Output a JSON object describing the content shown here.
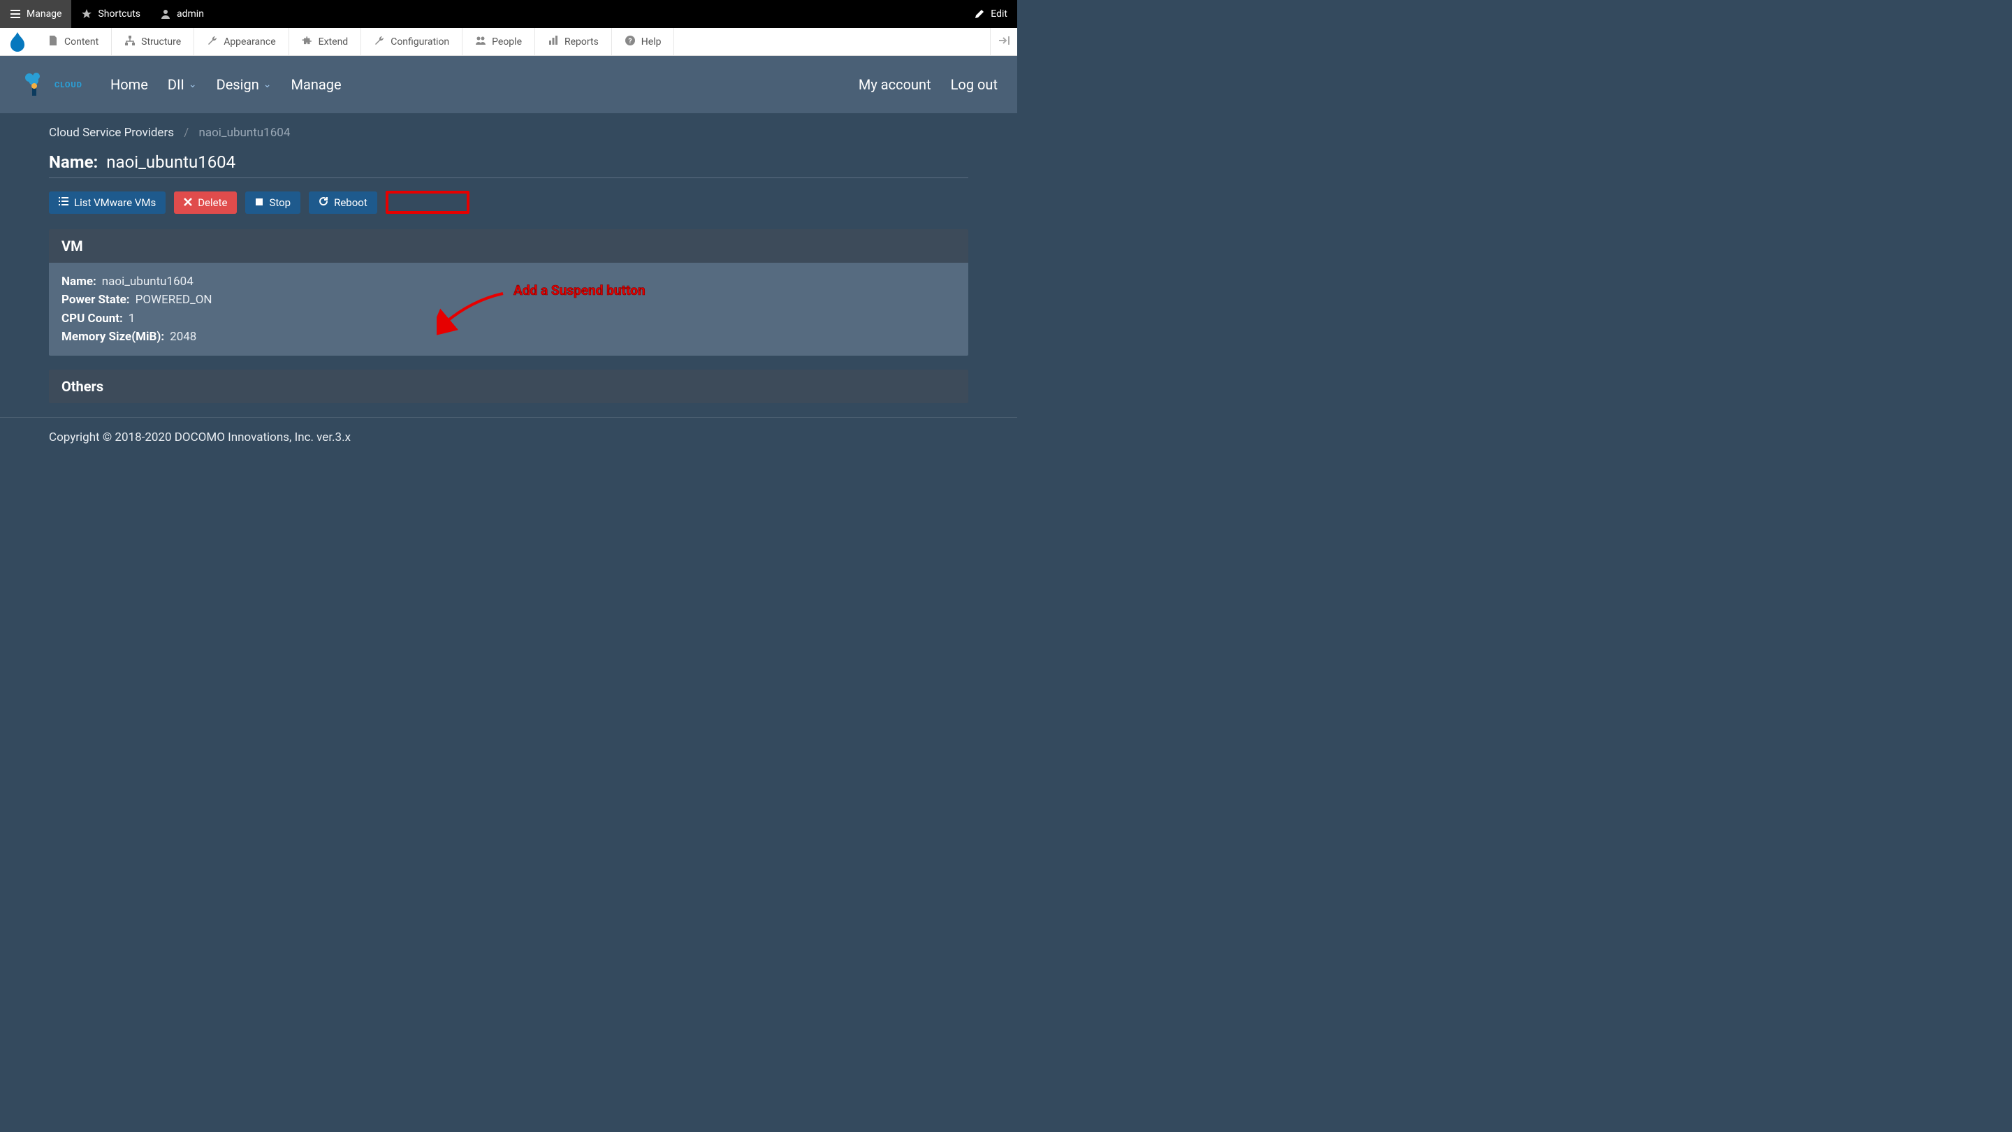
{
  "toolbar_top": {
    "manage": "Manage",
    "shortcuts": "Shortcuts",
    "admin": "admin",
    "edit": "Edit"
  },
  "toolbar_admin": {
    "items": [
      {
        "label": "Content"
      },
      {
        "label": "Structure"
      },
      {
        "label": "Appearance"
      },
      {
        "label": "Extend"
      },
      {
        "label": "Configuration"
      },
      {
        "label": "People"
      },
      {
        "label": "Reports"
      },
      {
        "label": "Help"
      }
    ]
  },
  "site_header": {
    "logo_text": "CLOUD",
    "nav": [
      "Home",
      "DII",
      "Design",
      "Manage"
    ],
    "right": [
      "My account",
      "Log out"
    ]
  },
  "breadcrumb": {
    "parent": "Cloud Service Providers",
    "current": "naoi_ubuntu1604"
  },
  "page_title": {
    "label": "Name:",
    "value": "naoi_ubuntu1604"
  },
  "buttons": {
    "list": "List VMware VMs",
    "delete": "Delete",
    "stop": "Stop",
    "reboot": "Reboot"
  },
  "annotation": {
    "text": "Add a Suspend button"
  },
  "panel_vm": {
    "title": "VM",
    "rows": [
      {
        "k": "Name:",
        "v": "naoi_ubuntu1604"
      },
      {
        "k": "Power State:",
        "v": "POWERED_ON"
      },
      {
        "k": "CPU Count:",
        "v": "1"
      },
      {
        "k": "Memory Size(MiB):",
        "v": "2048"
      }
    ]
  },
  "panel_others": {
    "title": "Others"
  },
  "footer": "Copyright © 2018-2020 DOCOMO Innovations, Inc. ver.3.x"
}
